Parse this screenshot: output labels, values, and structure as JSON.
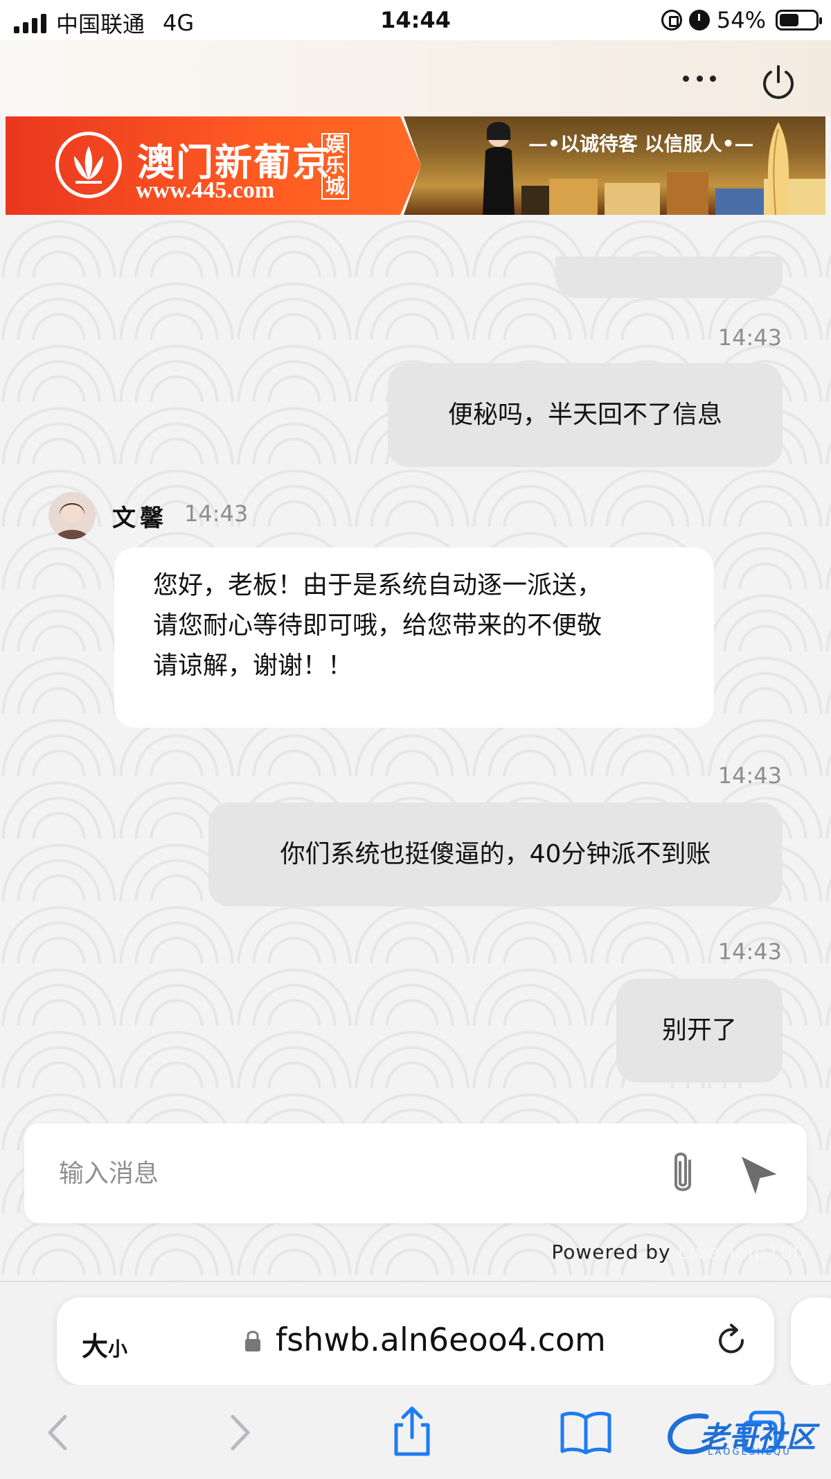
{
  "status_bar": {
    "carrier": "中国联通",
    "network": "4G",
    "time": "14:44",
    "battery_text": "54%",
    "battery_level": 0.54
  },
  "banner": {
    "name": "澳门新葡京",
    "url": "www.445.com",
    "tag": "娱乐城",
    "slogan": "—•以诚待客 以信服人•—"
  },
  "messages": {
    "partial_bubble": "",
    "m1": {
      "time": "14:43",
      "text": "便秘吗，半天回不了信息"
    },
    "agent": {
      "name": "文馨",
      "time": "14:43",
      "lines": [
        "您好，老板！由于是系统自动逐一派送，",
        "请您耐心等待即可哦，给您带来的不便敬",
        "请谅解，谢谢！！"
      ]
    },
    "m2": {
      "time": "14:43",
      "text": "你们系统也挺傻逼的，40分钟派不到账"
    },
    "m3": {
      "time": "14:43",
      "text": "别开了"
    }
  },
  "input": {
    "placeholder": "输入消息"
  },
  "powered": {
    "prefix": "Powered by",
    "brand": "LiveHelp100"
  },
  "browser": {
    "aa_big": "大",
    "aa_small": "小",
    "url": "fshwb.aln6eoo4.com"
  },
  "watermark": {
    "text": "老哥社区",
    "sub": "LAOGESHEQU"
  },
  "colors": {
    "bubble_out": "#e5e5e5",
    "bubble_in": "#ffffff",
    "time_gray": "#8d8d8d",
    "banner_orange": "#ff5a22",
    "accent_blue": "#1e7cf0"
  }
}
